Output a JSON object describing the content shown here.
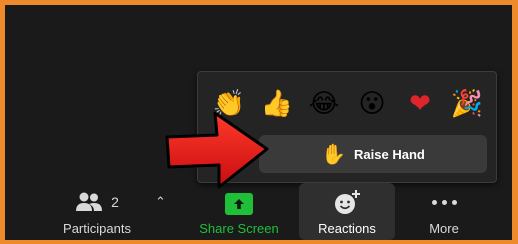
{
  "reactions_popup": {
    "emojis": [
      {
        "name": "clapping-hands",
        "glyph": "👏",
        "color": "#f5b914"
      },
      {
        "name": "thumbs-up",
        "glyph": "👍",
        "color": "#f5b914"
      },
      {
        "name": "tears-of-joy",
        "glyph": "😂",
        "color": "#f5b914"
      },
      {
        "name": "open-mouth",
        "glyph": "😮",
        "color": "#f5b914"
      },
      {
        "name": "red-heart",
        "glyph": "❤",
        "color": "#e0242b"
      },
      {
        "name": "party-popper",
        "glyph": "🎉",
        "color": "#f5b914"
      }
    ],
    "raise_hand": {
      "label": "Raise Hand",
      "icon": "raised-hand-icon",
      "glyph": "✋"
    }
  },
  "toolbar": {
    "participants": {
      "label": "Participants",
      "count": "2",
      "icon": "participants-icon"
    },
    "caret": {
      "glyph": "⌃",
      "icon": "chevron-up-icon"
    },
    "share_screen": {
      "label": "Share Screen",
      "icon": "share-screen-icon"
    },
    "reactions": {
      "label": "Reactions",
      "icon": "add-reaction-icon"
    },
    "more": {
      "label": "More",
      "icon": "more-dots-icon"
    }
  },
  "colors": {
    "frame_border": "#ef8a2b",
    "background": "#1a1a1a",
    "share_green": "#1fbf3a",
    "arrow_red": "#e8151a"
  }
}
